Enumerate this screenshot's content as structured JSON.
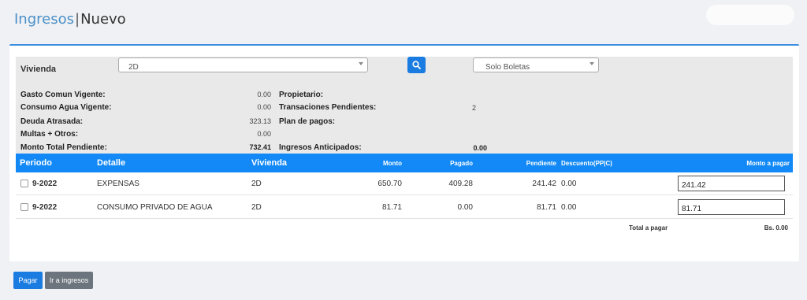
{
  "header": {
    "title_main": "Ingresos",
    "separator": "|",
    "title_sub": "Nuevo"
  },
  "filters": {
    "vivienda_label": "Vivienda",
    "vivienda_value": "2D",
    "tipo_value": "Solo Boletas",
    "search_icon": "search-icon"
  },
  "summary": {
    "gasto_label": "Gasto Comun Vigente:",
    "gasto_value": "0.00",
    "agua_label": "Consumo Agua Vigente:",
    "agua_value": "0.00",
    "deuda_label": "Deuda Atrasada:",
    "deuda_value": "323.13",
    "multas_label": "Multas + Otros:",
    "multas_value": "0.00",
    "monto_label": "Monto Total Pendiente:",
    "monto_value": "732.41",
    "propietario_label": "Propietario:",
    "trans_label": "Transaciones Pendientes:",
    "trans_value": "2",
    "plan_label": "Plan de pagos:",
    "anticipados_label": "Ingresos Anticipados:",
    "anticipados_value": "0.00"
  },
  "table": {
    "headers": {
      "periodo": "Periodo",
      "detalle": "Detalle",
      "vivienda": "Vivienda",
      "monto": "Monto",
      "pagado": "Pagado",
      "pendiente": "Pendiente",
      "descuento": "Descuento(PP|C)",
      "monto_pagar": "Monto a pagar"
    },
    "rows": [
      {
        "periodo": "9-2022",
        "detalle": "EXPENSAS",
        "vivienda": "2D",
        "monto": "650.70",
        "pagado": "409.28",
        "pendiente": "241.42",
        "descuento": "0.00",
        "monto_pagar": "241.42"
      },
      {
        "periodo": "9-2022",
        "detalle": "CONSUMO PRIVADO DE AGUA",
        "vivienda": "2D",
        "monto": "81.71",
        "pagado": "0.00",
        "pendiente": "81.71",
        "descuento": "0.00",
        "monto_pagar": "81.71"
      }
    ],
    "total_label": "Total a pagar",
    "total_value": "Bs. 0.00"
  },
  "actions": {
    "pagar": "Pagar",
    "ir_ingresos": "Ir a ingresos"
  },
  "colors": {
    "accent": "#1289f6",
    "primary_btn": "#1a7ce0",
    "secondary_btn": "#6c757d"
  }
}
